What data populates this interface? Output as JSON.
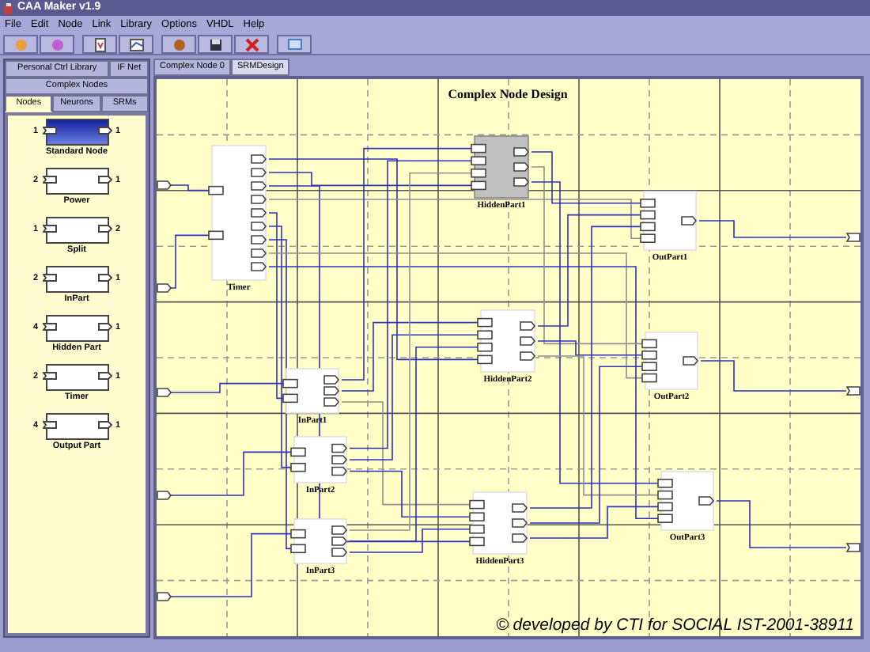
{
  "window": {
    "title": "CAA Maker v1.9"
  },
  "menu": [
    "File",
    "Edit",
    "Node",
    "Link",
    "Library",
    "Options",
    "VHDL",
    "Help"
  ],
  "library_tabs": {
    "top_row": [
      {
        "label": "Personal Ctrl Library",
        "selected": false
      },
      {
        "label": "IF Net",
        "selected": false
      }
    ],
    "middle_row": [
      {
        "label": "Complex Nodes",
        "selected": false
      }
    ],
    "bottom_row": [
      {
        "label": "Nodes",
        "selected": true
      },
      {
        "label": "Neurons",
        "selected": false
      },
      {
        "label": "SRMs",
        "selected": false
      }
    ]
  },
  "palette": [
    {
      "name": "Standard Node",
      "inputs": "1",
      "outputs": "1",
      "selected": true
    },
    {
      "name": "Power",
      "inputs": "2",
      "outputs": "1",
      "selected": false
    },
    {
      "name": "Split",
      "inputs": "1",
      "outputs": "2",
      "selected": false
    },
    {
      "name": "InPart",
      "inputs": "2",
      "outputs": "1",
      "selected": false
    },
    {
      "name": "Hidden Part",
      "inputs": "4",
      "outputs": "1",
      "selected": false
    },
    {
      "name": "Timer",
      "inputs": "2",
      "outputs": "1",
      "selected": false
    },
    {
      "name": "Output Part",
      "inputs": "4",
      "outputs": "1",
      "selected": false
    }
  ],
  "design_tabs": [
    {
      "label": "Complex Node 0",
      "selected": false
    },
    {
      "label": "SRMDesign",
      "selected": true
    }
  ],
  "canvas": {
    "title": "Complex Node Design",
    "nodes": [
      {
        "label": "Timer",
        "kind": "timer",
        "selected": false
      },
      {
        "label": "HiddenPart1",
        "kind": "hidden",
        "selected": true
      },
      {
        "label": "OutPart1",
        "kind": "output",
        "selected": false
      },
      {
        "label": "HiddenPart2",
        "kind": "hidden",
        "selected": false
      },
      {
        "label": "OutPart2",
        "kind": "output",
        "selected": false
      },
      {
        "label": "InPart1",
        "kind": "input",
        "selected": false
      },
      {
        "label": "InPart2",
        "kind": "input",
        "selected": false
      },
      {
        "label": "HiddenPart3",
        "kind": "hidden",
        "selected": false
      },
      {
        "label": "InPart3",
        "kind": "input",
        "selected": false
      },
      {
        "label": "OutPart3",
        "kind": "output",
        "selected": false
      }
    ],
    "credit": "© developed by CTI for SOCIAL IST-2001-38911"
  }
}
